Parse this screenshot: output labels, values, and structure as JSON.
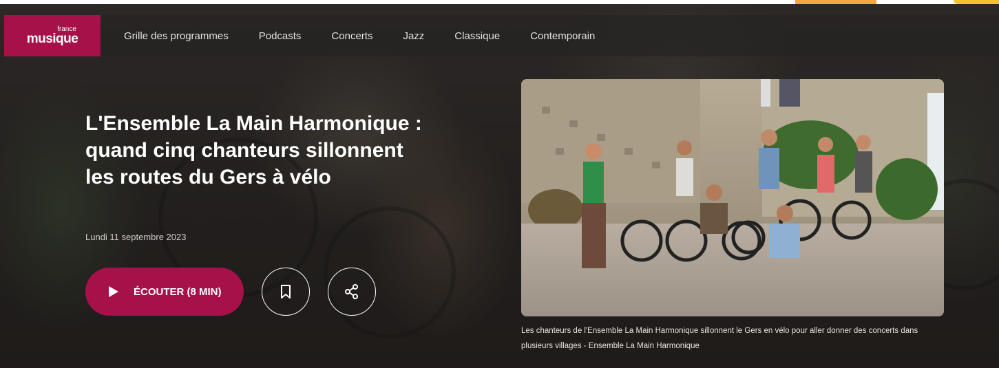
{
  "nav": {
    "logo_small": "france",
    "logo_big": "musique",
    "items": [
      {
        "label": "Grille des programmes"
      },
      {
        "label": "Podcasts"
      },
      {
        "label": "Concerts"
      },
      {
        "label": "Jazz"
      },
      {
        "label": "Classique"
      },
      {
        "label": "Contemporain"
      }
    ]
  },
  "article": {
    "title": "L'Ensemble La Main Harmonique : quand cinq chanteurs sillonnent les routes du Gers à vélo",
    "date": "Lundi 11 septembre 2023",
    "listen_label": "ÉCOUTER (8 MIN)",
    "caption": "Les chanteurs de l'Ensemble La Main Harmonique sillonnent le Gers en vélo pour aller donner des concerts dans plusieurs villages - Ensemble La Main Harmonique"
  },
  "colors": {
    "brand": "#a7114a",
    "accent_orange": "#f4a640",
    "accent_yellow": "#f2c230"
  },
  "icons": {
    "play": "play-icon",
    "bookmark": "bookmark-icon",
    "share": "share-icon"
  }
}
